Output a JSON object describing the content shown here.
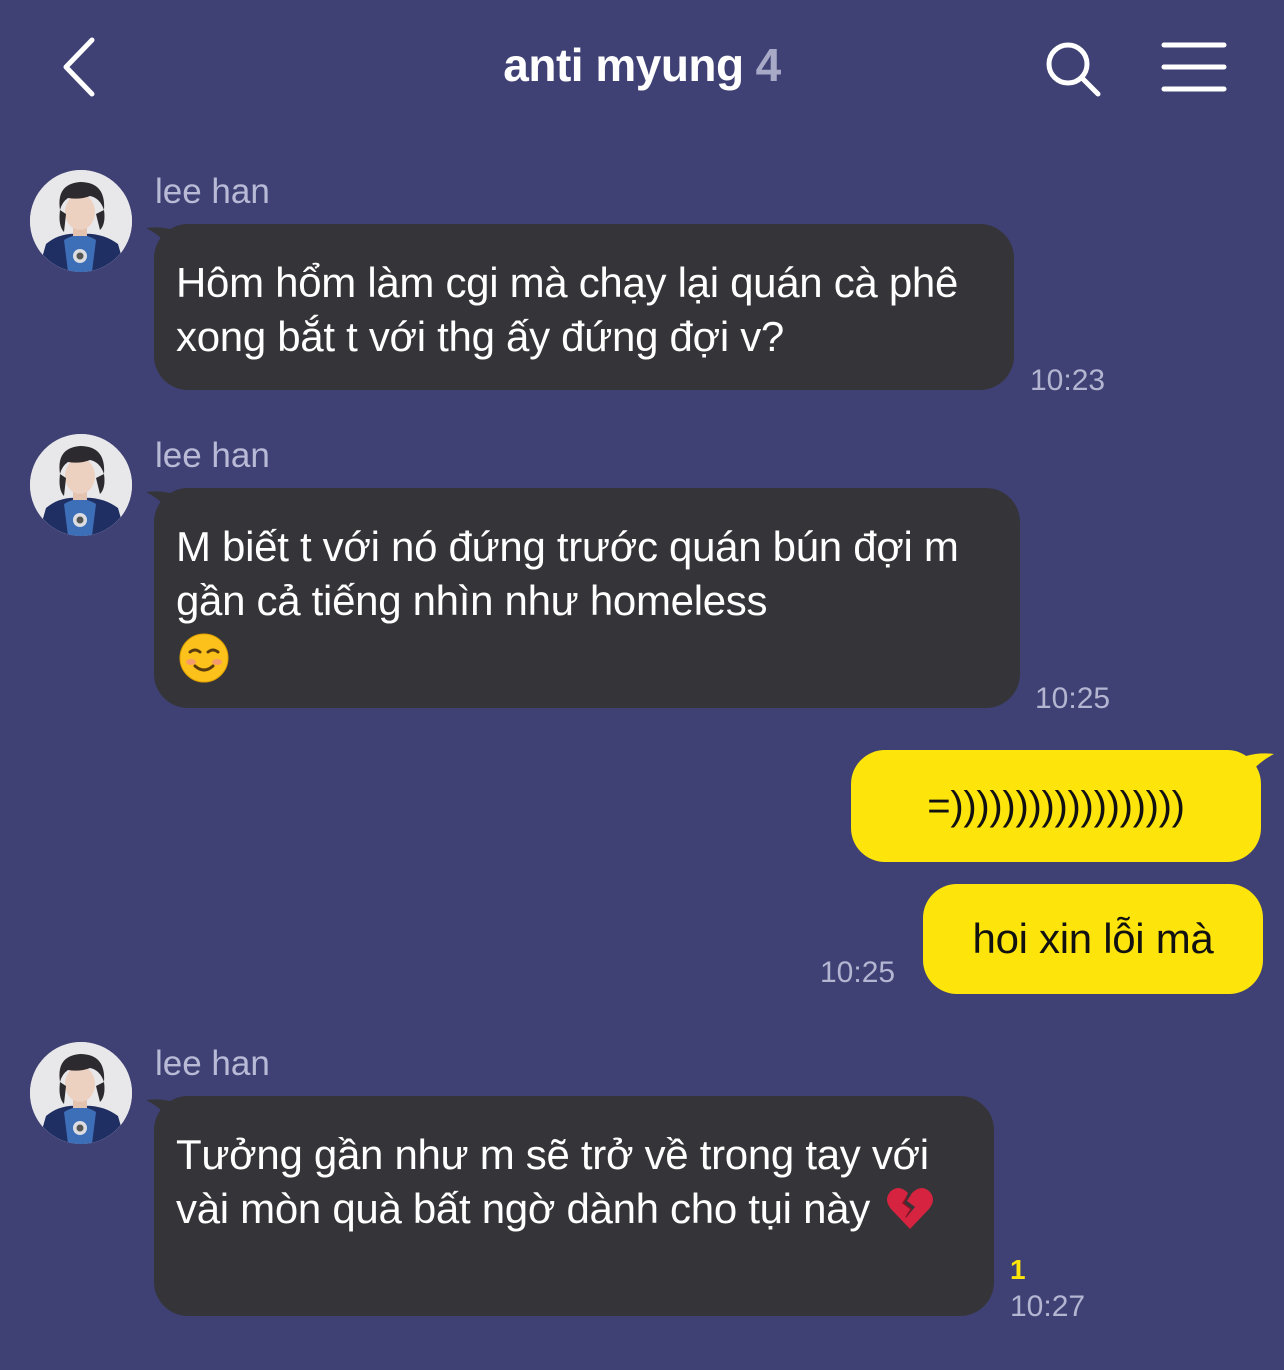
{
  "header": {
    "chat_name": "anti myung",
    "member_count": "4",
    "back_icon": "chevron-left-icon",
    "search_icon": "search-icon",
    "menu_icon": "hamburger-menu-icon"
  },
  "messages": [
    {
      "sender": "lee han",
      "text": "Hôm hổm làm cgi mà chạy lại quán cà phê xong bắt t với thg ấy đứng đợi v?",
      "time": "10:23"
    },
    {
      "sender": "lee han",
      "text": "M biết t với nó đứng trước quán bún đợi m gần cả tiếng nhìn như homeless",
      "emoji": "smiling-face-icon",
      "time": "10:25"
    },
    {
      "text": "=))))))))))))))))))"
    },
    {
      "text": "hoi xin lỗi mà",
      "time": "10:25"
    },
    {
      "sender": "lee han",
      "text": "Tưởng gần như m sẽ trở về trong tay với vài mòn quà bất ngờ dành cho tụi này",
      "emoji": "broken-heart-icon",
      "unread": "1",
      "time": "10:27"
    }
  ],
  "colors": {
    "background": "#3f4175",
    "incoming_bubble": "#353539",
    "outgoing_bubble": "#fde40a",
    "timestamp": "#b4b5d1",
    "unread": "#fde40a"
  }
}
